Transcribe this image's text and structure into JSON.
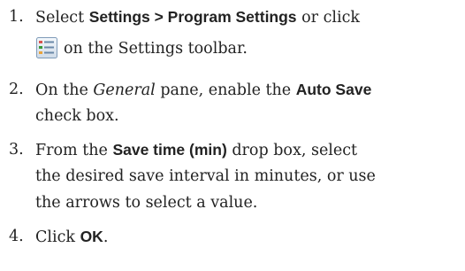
{
  "steps": [
    {
      "number": "1.",
      "line1_a": "Select ",
      "line1_b": "Settings > Program Settings",
      "line1_c": " or click",
      "line2": "on the Settings toolbar.",
      "icon": "program-settings-icon"
    },
    {
      "number": "2.",
      "line1_a": "On the ",
      "line1_b": "General",
      "line1_c": " pane, enable the ",
      "line1_d": "Auto Save",
      "line2": "check box."
    },
    {
      "number": "3.",
      "line1_a": "From the ",
      "line1_b": "Save time (min)",
      "line1_c": " drop box, select",
      "line2": "the desired save interval in minutes, or use",
      "line3": "the arrows to select a value."
    },
    {
      "number": "4.",
      "line1_a": "Click ",
      "line1_b": "OK",
      "line1_c": "."
    }
  ]
}
